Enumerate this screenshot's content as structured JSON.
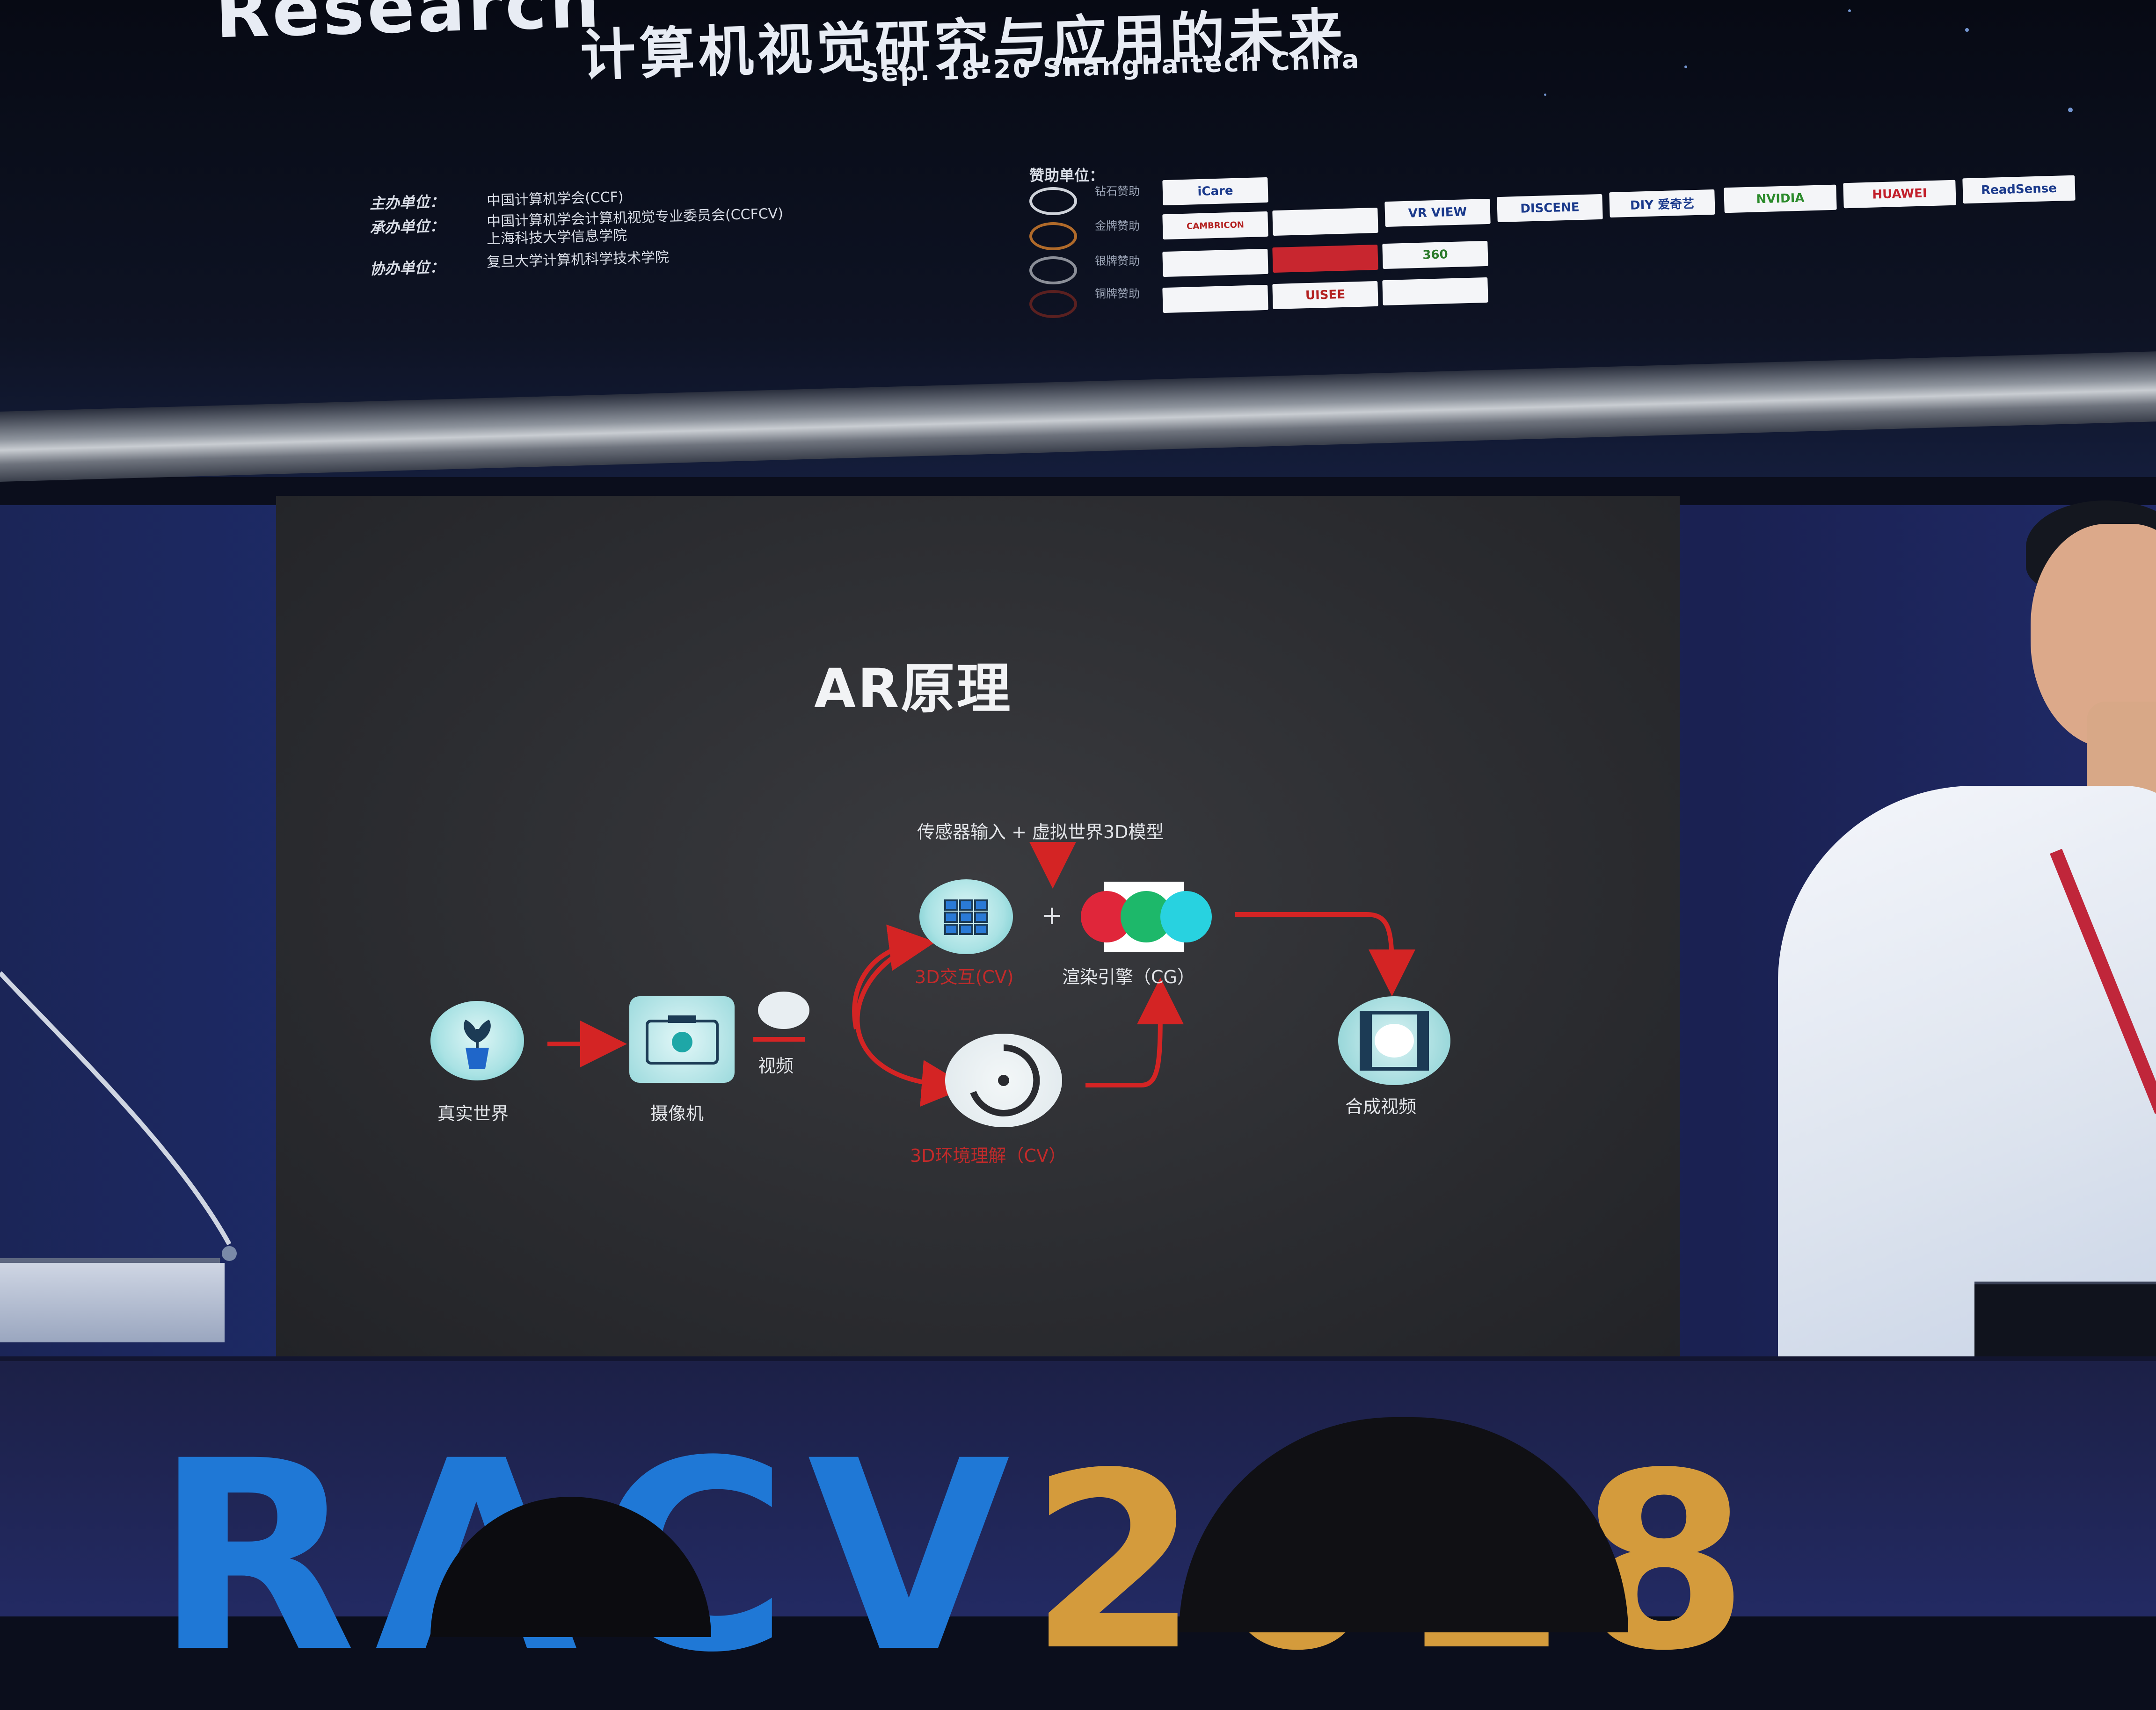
{
  "banner": {
    "title_en": "Research",
    "title_zh": "计算机视觉研究与应用的未来",
    "date_line": "Sep. 18-20 Shanghaitech China",
    "organizers": [
      {
        "label": "主办单位：",
        "value": "中国计算机学会(CCF)"
      },
      {
        "label": "承办单位：",
        "value": "中国计算机学会计算机视觉专业委员会(CCFCV)"
      },
      {
        "label": "",
        "value": "上海科技大学信息学院"
      },
      {
        "label": "协办单位：",
        "value": "复旦大学计算机科学技术学院"
      }
    ],
    "sponsors_title": "赞助单位：",
    "sponsor_tiers": [
      "钻石赞助",
      "金牌赞助",
      "银牌赞助",
      "铜牌赞助"
    ],
    "sponsor_logos": {
      "row1": [
        "iCare",
        "VR VIEW",
        "DISCENE",
        "DIY 爱奇艺",
        "NVIDIA",
        "HUAWEI",
        "ReadSense"
      ],
      "row2": [
        "CAMBRICON",
        "",
        ""
      ],
      "row3": [
        "360",
        "",
        ""
      ],
      "row4": [
        "",
        "UISEE",
        ""
      ]
    }
  },
  "slide": {
    "title": "AR原理",
    "top_label": "传感器输入 + 虚拟世界3D模型",
    "nodes": {
      "real_world": "真实世界",
      "camera": "摄像机",
      "video": "视频",
      "interaction": "3D交互(CV)",
      "render_engine": "渲染引擎（CG）",
      "environment": "3D环境理解（CV）",
      "composite": "合成视频"
    },
    "plus_sign": "+"
  },
  "bottom": {
    "event_text": "RACV",
    "event_year": "2018"
  },
  "colors": {
    "accent_red": "#d42424",
    "node_cyan": "#8fd9dc",
    "event_blue": "#1f78d6",
    "event_gold": "#d49b3c"
  }
}
